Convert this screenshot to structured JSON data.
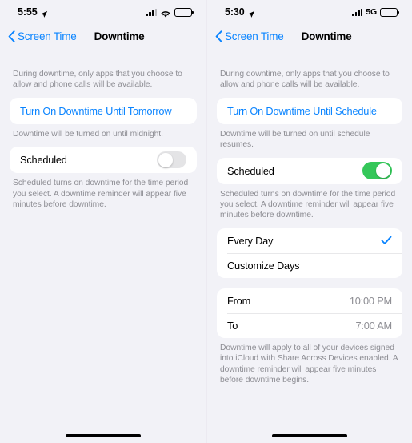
{
  "panels": [
    {
      "status": {
        "time": "5:55",
        "location_icon": "location-arrow-icon",
        "signal_icon": "cellular-signal-icon",
        "connectivity_label": "",
        "connectivity_icon": "wifi-icon",
        "battery_icon": "battery-icon"
      },
      "nav": {
        "back_label": "Screen Time",
        "back_icon": "chevron-left-icon",
        "title": "Downtime"
      },
      "intro_text": "During downtime, only apps that you choose to allow and phone calls will be available.",
      "action": {
        "label": "Turn On Downtime Until Tomorrow"
      },
      "action_footnote": "Downtime will be turned on until midnight.",
      "scheduled": {
        "label": "Scheduled",
        "state": "off"
      },
      "scheduled_footnote": "Scheduled turns on downtime for the time period you select. A downtime reminder will appear five minutes before downtime.",
      "days": null,
      "times": null,
      "times_footnote": null
    },
    {
      "status": {
        "time": "5:30",
        "location_icon": "location-arrow-icon",
        "signal_icon": "cellular-signal-icon",
        "connectivity_label": "5G",
        "connectivity_icon": "network-type-label",
        "battery_icon": "battery-icon"
      },
      "nav": {
        "back_label": "Screen Time",
        "back_icon": "chevron-left-icon",
        "title": "Downtime"
      },
      "intro_text": "During downtime, only apps that you choose to allow and phone calls will be available.",
      "action": {
        "label": "Turn On Downtime Until Schedule"
      },
      "action_footnote": "Downtime will be turned on until schedule resumes.",
      "scheduled": {
        "label": "Scheduled",
        "state": "on"
      },
      "scheduled_footnote": "Scheduled turns on downtime for the time period you select. A downtime reminder will appear five minutes before downtime.",
      "days": {
        "options": [
          {
            "label": "Every Day",
            "selected": true
          },
          {
            "label": "Customize Days",
            "selected": false
          }
        ]
      },
      "times": {
        "from_label": "From",
        "from_value": "10:00 PM",
        "to_label": "To",
        "to_value": "7:00 AM"
      },
      "times_footnote": "Downtime will apply to all of your devices signed into iCloud with Share Across Devices enabled. A downtime reminder will appear five minutes before downtime begins."
    }
  ],
  "colors": {
    "accent_blue": "#0a84ff",
    "toggle_on_green": "#34c759",
    "background": "#f2f2f7",
    "card": "#ffffff",
    "secondary_text": "#8d8d93"
  }
}
